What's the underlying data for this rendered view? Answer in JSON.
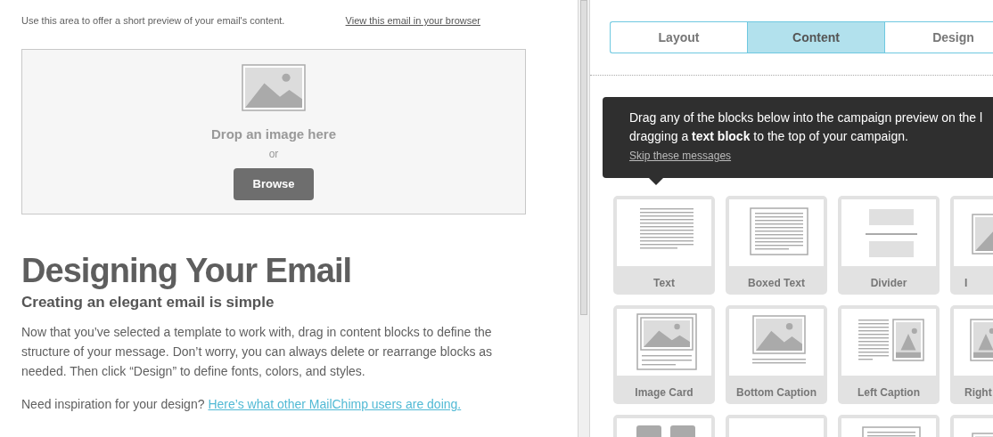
{
  "preview": {
    "preheader": "Use this area to offer a short preview of your email's content.",
    "browser_link": "View this email in your browser",
    "image_drop": {
      "prompt": "Drop an image here",
      "or": "or",
      "button": "Browse"
    },
    "title": "Designing Your Email",
    "subtitle": "Creating an elegant email is simple",
    "body": "Now that you’ve selected a template to work with, drag in content blocks to define the structure of your message. Don’t worry, you can always delete or rearrange blocks as needed. Then click “Design” to define fonts, colors, and styles.",
    "inspiration": "Need inspiration for your design?",
    "inspiration_link": "Here’s what other MailChimp users are doing."
  },
  "tabs": [
    {
      "label": "Layout",
      "selected": false
    },
    {
      "label": "Content",
      "selected": true
    },
    {
      "label": "Design",
      "selected": false
    }
  ],
  "tip": {
    "lines": [
      "Drag any of the blocks below into the campaign preview on the l",
      "dragging a **text block** to the top of your campaign."
    ],
    "skip": "Skip these messages"
  },
  "blocks": [
    {
      "kind": "text",
      "label": "Text"
    },
    {
      "kind": "boxed",
      "label": "Boxed Text"
    },
    {
      "kind": "divider",
      "label": "Divider"
    },
    {
      "kind": "image",
      "label": "I"
    },
    {
      "kind": "image-card",
      "label": "Image Card"
    },
    {
      "kind": "bottom-caption",
      "label": "Bottom Caption"
    },
    {
      "kind": "left-caption",
      "label": "Left Caption"
    },
    {
      "kind": "right-caption",
      "label": "Right"
    },
    {
      "kind": "social"
    },
    {
      "kind": "blank"
    },
    {
      "kind": "boxed"
    },
    {
      "kind": "image"
    }
  ]
}
